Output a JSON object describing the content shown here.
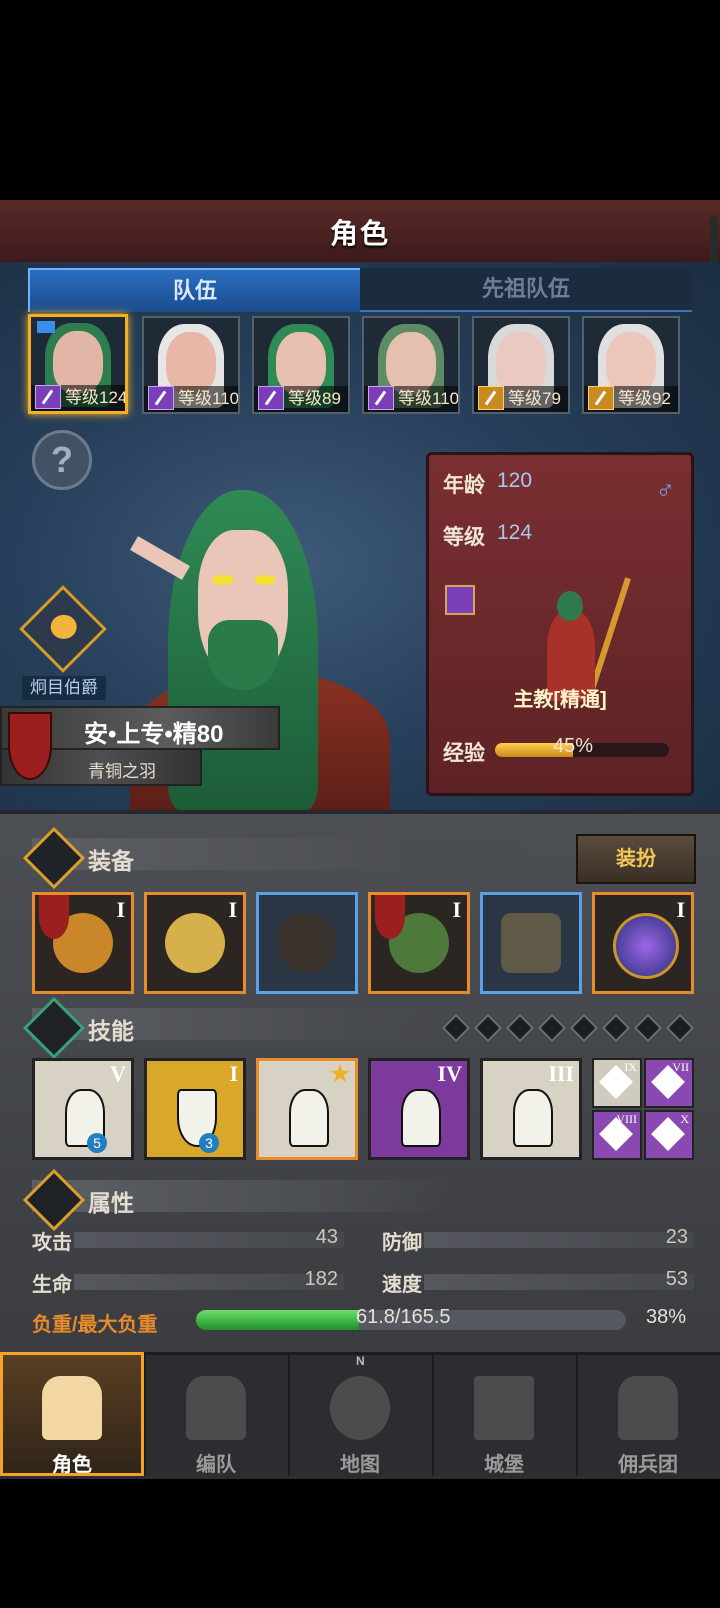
{
  "header": {
    "title": "角色"
  },
  "tabs": [
    {
      "label": "队伍",
      "active": true
    },
    {
      "label": "先祖队伍",
      "active": false
    }
  ],
  "party": [
    {
      "level": "等级124",
      "selected": true,
      "hair": "#2e7d4f",
      "skin": "#e2b6a6",
      "staff": "purple"
    },
    {
      "level": "等级110",
      "selected": false,
      "hair": "#e6e6e6",
      "skin": "#e8b7a7",
      "staff": "purple"
    },
    {
      "level": "等级89",
      "selected": false,
      "hair": "#2f8a55",
      "skin": "#e8c0b2",
      "staff": "purple"
    },
    {
      "level": "等级110",
      "selected": false,
      "hair": "#5d8b66",
      "skin": "#e4c0ae",
      "staff": "purple"
    },
    {
      "level": "等级79",
      "selected": false,
      "hair": "#d9d9d9",
      "skin": "#e9c9c0",
      "staff": "gold"
    },
    {
      "level": "等级92",
      "selected": false,
      "hair": "#e0e0e0",
      "skin": "#ecc6bb",
      "staff": "gold"
    }
  ],
  "hero": {
    "title": "炯目伯爵",
    "name": "安•上专•精80",
    "guild": "青铜之羽"
  },
  "info_card": {
    "age_label": "年龄",
    "age": "120",
    "gender": "♂",
    "level_label": "等级",
    "level": "124",
    "class": "主教[精通]",
    "exp_label": "经验",
    "exp_value": "45%",
    "exp_fraction": 0.45
  },
  "equipment": {
    "label": "装备",
    "dress_button": "装扮",
    "items": [
      {
        "tier": "I",
        "rarity": "orange",
        "color": "#c9872a",
        "flag": true
      },
      {
        "tier": "I",
        "rarity": "orange",
        "color": "#d6b04a",
        "flag": false
      },
      {
        "tier": "",
        "rarity": "blue",
        "color": "#3a332d",
        "flag": false
      },
      {
        "tier": "I",
        "rarity": "orange",
        "color": "#4d7a3a",
        "flag": true
      },
      {
        "tier": "",
        "rarity": "blue",
        "color": "#5f5a48",
        "flag": false
      },
      {
        "tier": "I",
        "rarity": "orange",
        "color": "#3b3f9e",
        "flag": false
      }
    ]
  },
  "skills": {
    "label": "技能",
    "slots_empty": 8,
    "items": [
      {
        "tier": "V",
        "badge": "5",
        "bg": "#d7d2c4",
        "border": "#222"
      },
      {
        "tier": "I",
        "badge": "3",
        "bg": "#d9a82a",
        "border": "#222"
      },
      {
        "tier": "",
        "badge": "",
        "bg": "#d7d2c4",
        "border": "#e88b2d"
      },
      {
        "tier": "IV",
        "badge": "",
        "bg": "#7c3a9c",
        "border": "#222"
      },
      {
        "tier": "III",
        "badge": "",
        "bg": "#d7d2c4",
        "border": "#222"
      }
    ],
    "minis": [
      {
        "tier": "IX",
        "bg": "#cfcbbf"
      },
      {
        "tier": "VII",
        "bg": "#8a49b0"
      },
      {
        "tier": "VIII",
        "bg": "#8a49b0"
      },
      {
        "tier": "X",
        "bg": "#8a49b0"
      }
    ]
  },
  "attributes": {
    "label": "属性",
    "attack_label": "攻击",
    "attack": "43",
    "defense_label": "防御",
    "defense": "23",
    "life_label": "生命",
    "life": "182",
    "speed_label": "速度",
    "speed": "53",
    "load_label": "负重/最大负重",
    "load": "61.8/165.5",
    "load_pct": "38%",
    "load_fraction": 0.38
  },
  "nav": [
    {
      "label": "角色",
      "active": true
    },
    {
      "label": "编队",
      "active": false
    },
    {
      "label": "地图",
      "active": false
    },
    {
      "label": "城堡",
      "active": false
    },
    {
      "label": "佣兵团",
      "active": false
    }
  ],
  "compass": "N"
}
